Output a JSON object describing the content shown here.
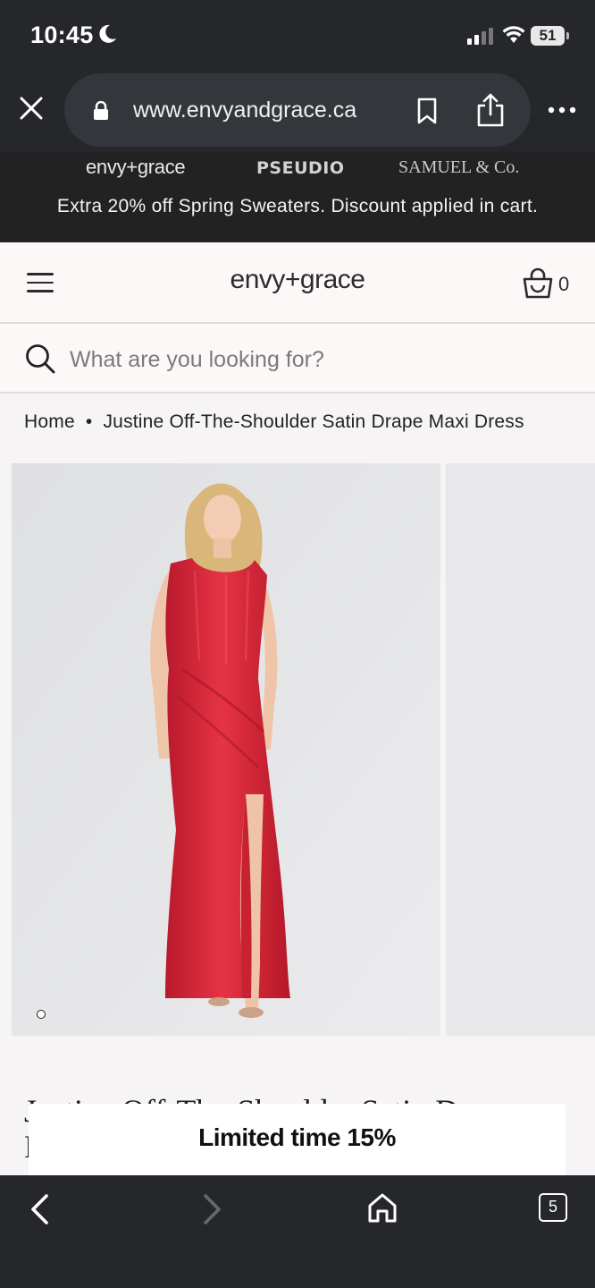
{
  "status_bar": {
    "time": "10:45",
    "battery": "51"
  },
  "browser": {
    "url": "www.envyandgrace.ca",
    "tab_count": "5"
  },
  "brand_strip": {
    "brands": [
      "envy+grace",
      "PSEUDIO",
      "SAMUEL & Co."
    ],
    "promo": "Extra 20% off Spring Sweaters. Discount applied in cart."
  },
  "header": {
    "logo": "envy+grace",
    "cart_count": "0"
  },
  "search": {
    "placeholder": "What are you looking for?"
  },
  "breadcrumb": {
    "home": "Home",
    "separator": "•",
    "current": "Justine Off-The-Shoulder Satin Drape Maxi Dress"
  },
  "product": {
    "title_line1": "Justine Off-The-Shoulder Satin Dr",
    "title_line2": "M"
  },
  "popup": {
    "text": "Limited time 15%"
  },
  "colors": {
    "chrome": "#25272b",
    "dress": "#d8283a"
  }
}
